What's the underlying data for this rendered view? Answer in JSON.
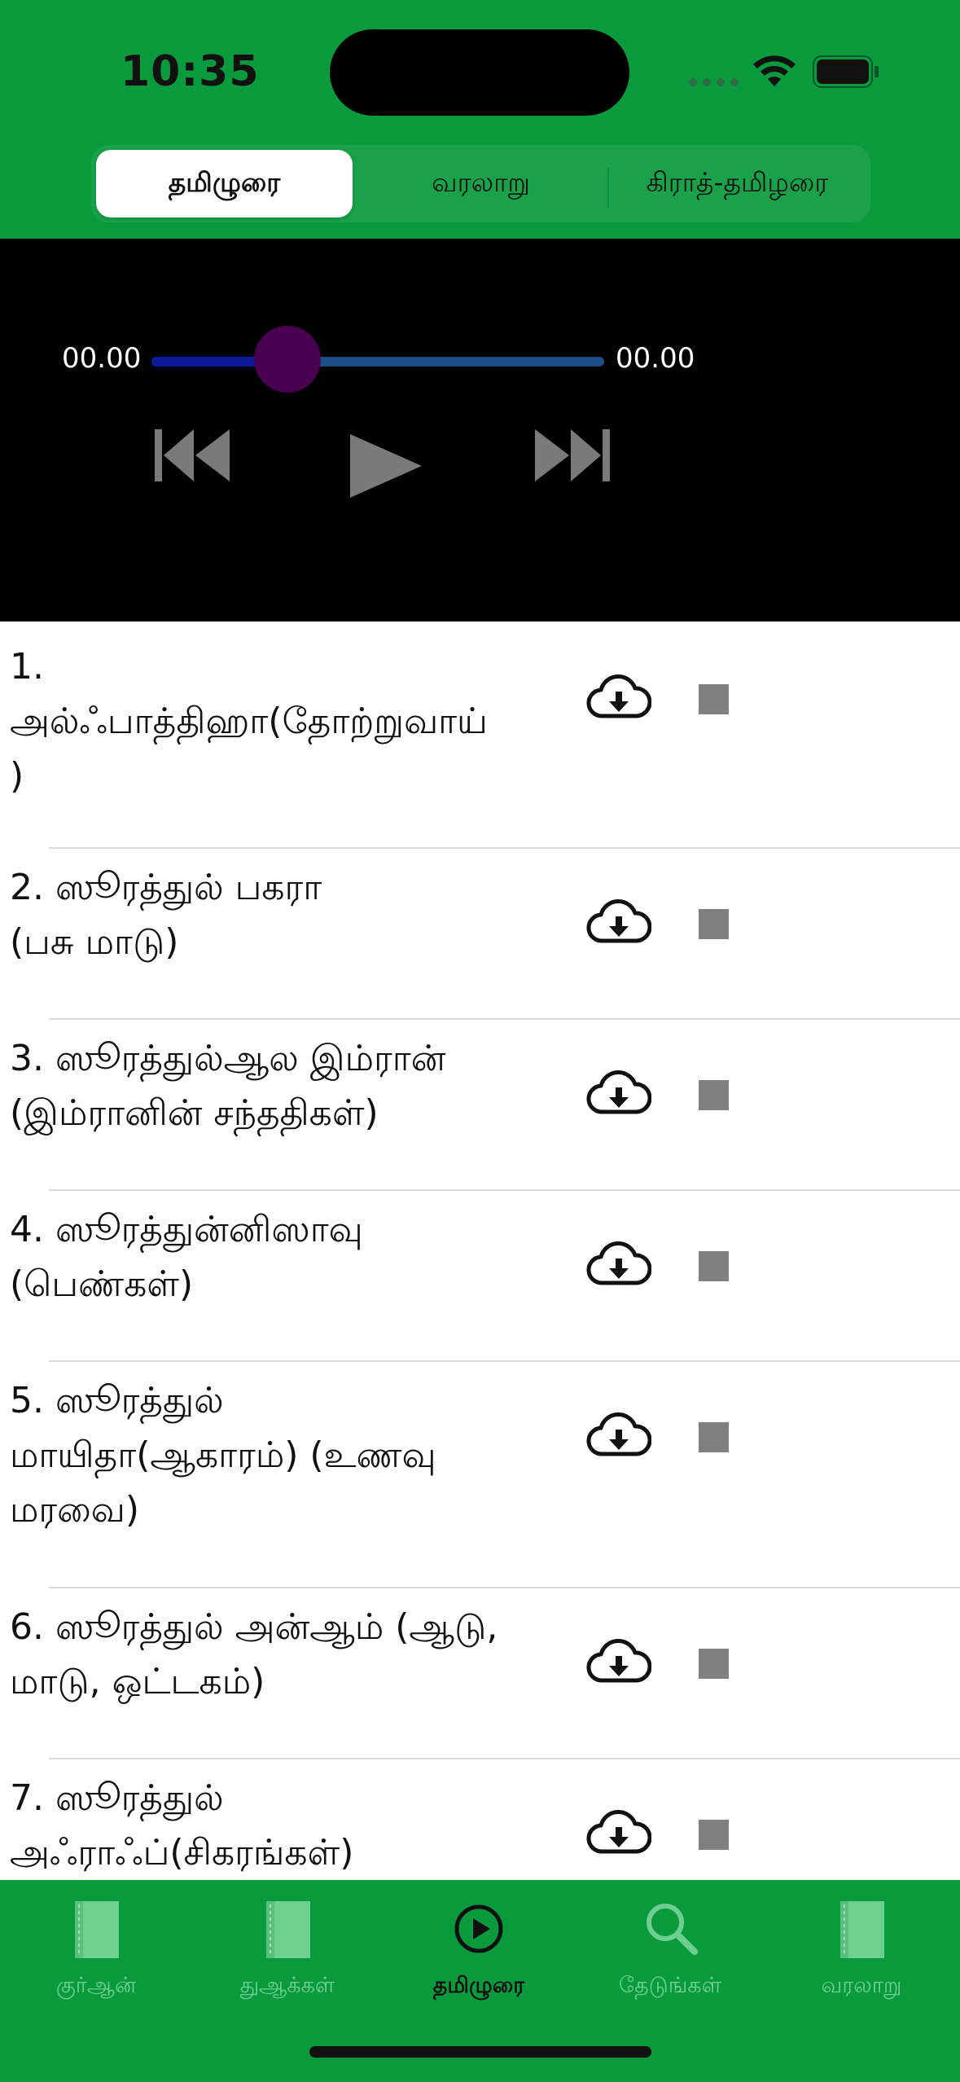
{
  "status": {
    "time": "10:35"
  },
  "segments": [
    {
      "label": "தமிழுரை",
      "active": true
    },
    {
      "label": "வரலாறு",
      "active": false
    },
    {
      "label": "கிராத்-தமிழரை",
      "active": false
    }
  ],
  "player": {
    "current_time": "00.00",
    "total_time": "00.00",
    "progress_fraction": 0.3
  },
  "list": [
    {
      "text": "1.\nஅல்ஃபாத்திஹா(தோற்றுவாய்\n)"
    },
    {
      "text": "2. ஸூரத்துல் பகரா\n(பசு மாடு)"
    },
    {
      "text": "3. ஸூரத்துல்ஆல இம்ரான்\n(இம்ரானின் சந்ததிகள்)"
    },
    {
      "text": "4. ஸூரத்துன்னிஸாவு\n(பெண்கள்)"
    },
    {
      "text": "5. ஸூரத்துல்\nமாயிதா(ஆகாரம்) (உணவு\nமரவை)"
    },
    {
      "text": "6. ஸூரத்துல் அன்ஆம் (ஆடு,\nமாடு, ஒட்டகம்)"
    },
    {
      "text": "7. ஸூரத்துல்\nஅஃராஃப்(சிகரங்கள்)"
    }
  ],
  "tabs": [
    {
      "label": "குர்ஆன்",
      "icon": "book-icon",
      "active": false
    },
    {
      "label": "துஆக்கள்",
      "icon": "book-icon",
      "active": false
    },
    {
      "label": "தமிழுரை",
      "icon": "play-circle-icon",
      "active": true
    },
    {
      "label": "தேடுங்கள்",
      "icon": "search-icon",
      "active": false
    },
    {
      "label": "வரலாறு",
      "icon": "book-icon",
      "active": false
    }
  ],
  "colors": {
    "brand_green": "#0a9a3e",
    "player_bg": "#000000",
    "slider_thumb": "#4a0050",
    "inactive_tab": "#6fcf8f"
  }
}
